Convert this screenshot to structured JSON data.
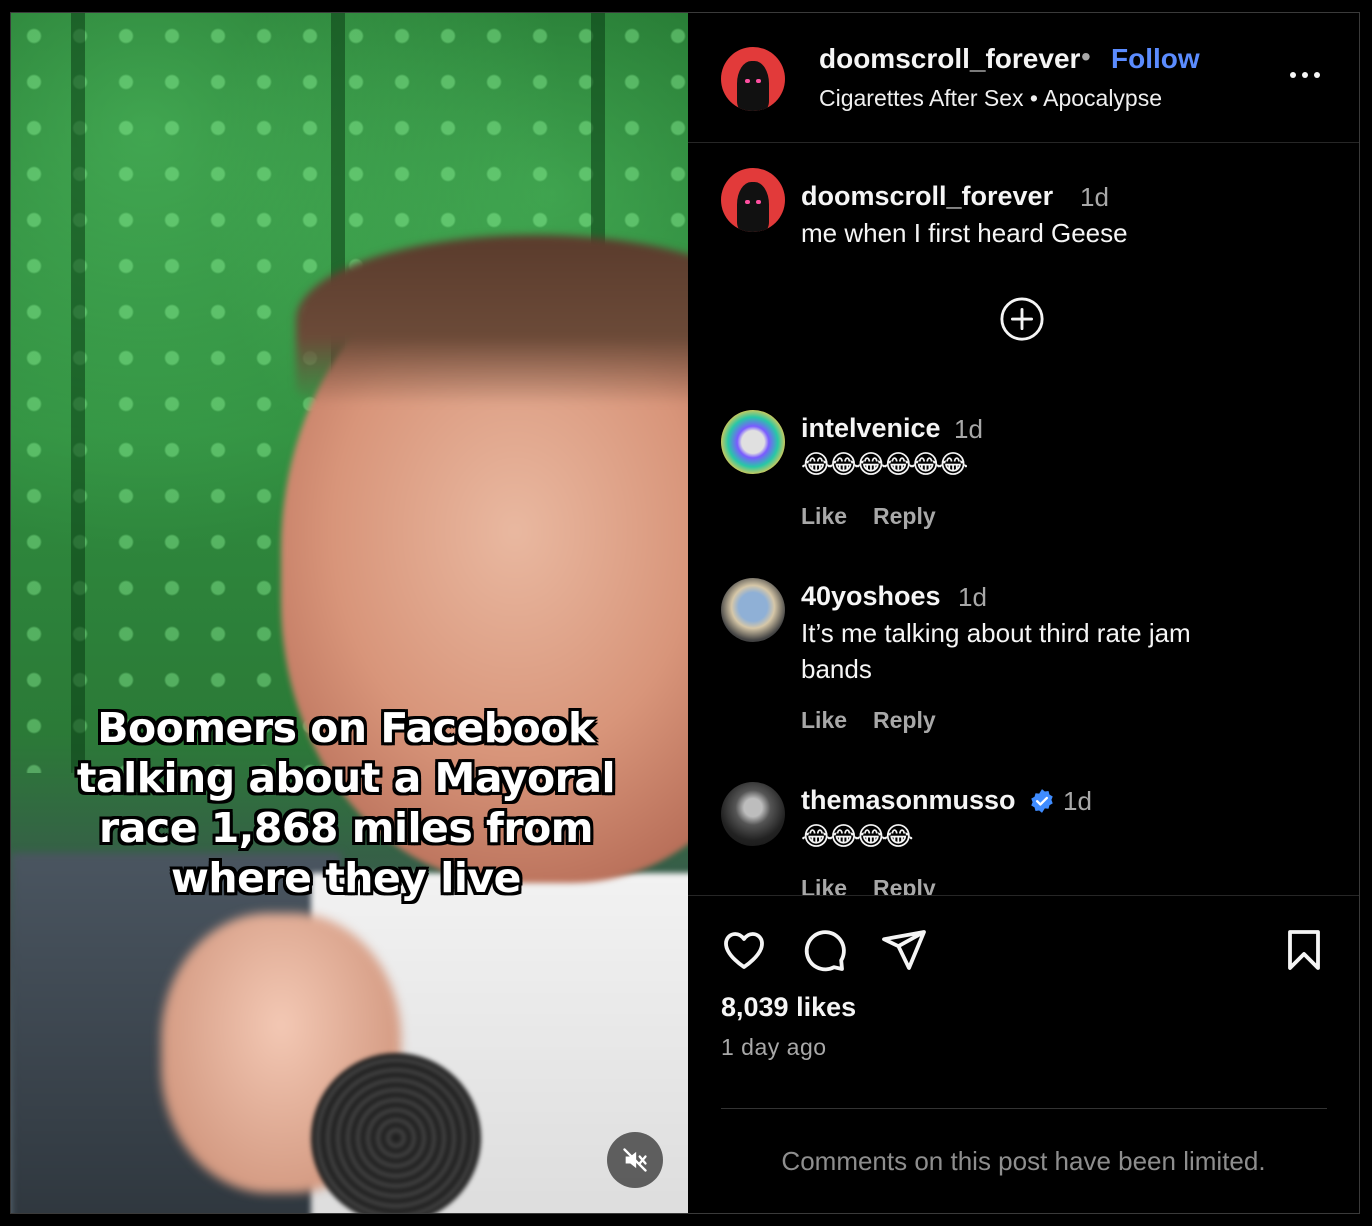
{
  "post": {
    "caption_overlay": "Boomers on Facebook talking about a Mayoral race 1,868 miles from where they live"
  },
  "header": {
    "username": "doomscroll_forever",
    "separator": "•",
    "follow_label": "Follow",
    "audio": "Cigarettes After Sex • Apocalypse",
    "more_icon": "more-horizontal-icon"
  },
  "caption_comment": {
    "username": "doomscroll_forever",
    "time": "1d",
    "text": "me when I first heard Geese"
  },
  "load_more_icon": "plus-circle-icon",
  "comments": [
    {
      "username": "intelvenice",
      "time": "1d",
      "text": "😂😂😂😂😂😂",
      "like_label": "Like",
      "reply_label": "Reply"
    },
    {
      "username": "40yoshoes",
      "time": "1d",
      "text": "It’s me talking about third rate jam bands",
      "like_label": "Like",
      "reply_label": "Reply"
    },
    {
      "username": "themasonmusso",
      "verified": true,
      "time": "1d",
      "text": "😂😂😂😂",
      "like_label": "Like",
      "reply_label": "Reply"
    }
  ],
  "actions": {
    "likes": "8,039 likes",
    "time_ago": "1 day ago",
    "limited_notice": "Comments on this post have been limited."
  },
  "colors": {
    "background": "#000000",
    "link": "#5b8cff",
    "muted": "#a8a8a8",
    "verified": "#3f8cff"
  }
}
